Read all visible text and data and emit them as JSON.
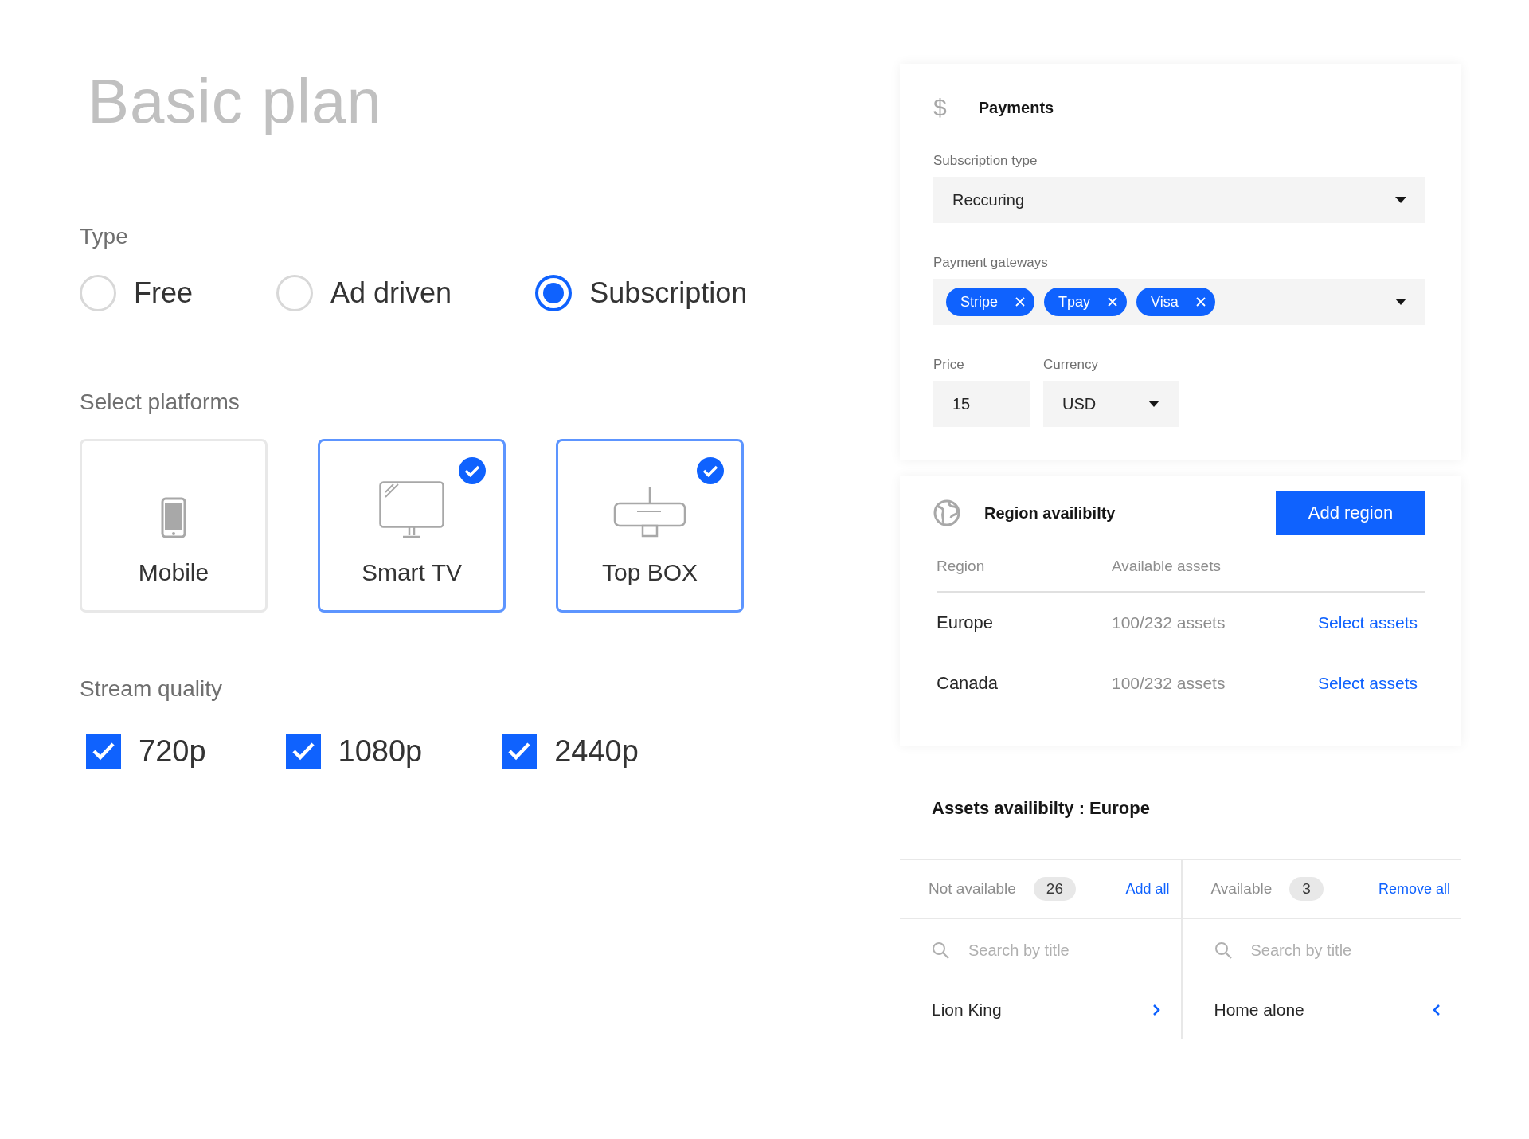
{
  "title": "Basic plan",
  "type_section": {
    "label": "Type",
    "options": [
      {
        "label": "Free",
        "selected": false
      },
      {
        "label": "Ad driven",
        "selected": false
      },
      {
        "label": "Subscription",
        "selected": true
      }
    ]
  },
  "platforms_section": {
    "label": "Select platforms",
    "platforms": [
      {
        "label": "Mobile",
        "kind": "phone",
        "selected": false
      },
      {
        "label": "Smart TV",
        "kind": "tv",
        "selected": true
      },
      {
        "label": "Top BOX",
        "kind": "box",
        "selected": true
      }
    ]
  },
  "quality_section": {
    "label": "Stream quality",
    "options": [
      {
        "label": "720p",
        "checked": true
      },
      {
        "label": "1080p",
        "checked": true
      },
      {
        "label": "2440p",
        "checked": true
      }
    ]
  },
  "payments": {
    "icon": "$",
    "title": "Payments",
    "subscription_type": {
      "label": "Subscription type",
      "value": "Reccuring"
    },
    "gateways": {
      "label": "Payment gateways",
      "tags": [
        "Stripe",
        "Tpay",
        "Visa"
      ]
    },
    "price": {
      "label": "Price",
      "value": "15"
    },
    "currency": {
      "label": "Currency",
      "value": "USD"
    }
  },
  "regions": {
    "title": "Region availibilty",
    "add_button": "Add region",
    "columns": [
      "Region",
      "Available assets"
    ],
    "rows": [
      {
        "region": "Europe",
        "assets": "100/232 assets",
        "action": "Select assets"
      },
      {
        "region": "Canada",
        "assets": "100/232 assets",
        "action": "Select assets"
      }
    ]
  },
  "assets": {
    "title": "Assets availibilty : Europe",
    "lists": [
      {
        "label": "Not available",
        "count": "26",
        "action": "Add all",
        "placeholder": "Search by title",
        "items": [
          "Lion King"
        ],
        "kind": "add"
      },
      {
        "label": "Available",
        "count": "3",
        "action": "Remove all",
        "placeholder": "Search by title",
        "items": [
          "Home alone"
        ],
        "kind": "remove"
      }
    ]
  }
}
